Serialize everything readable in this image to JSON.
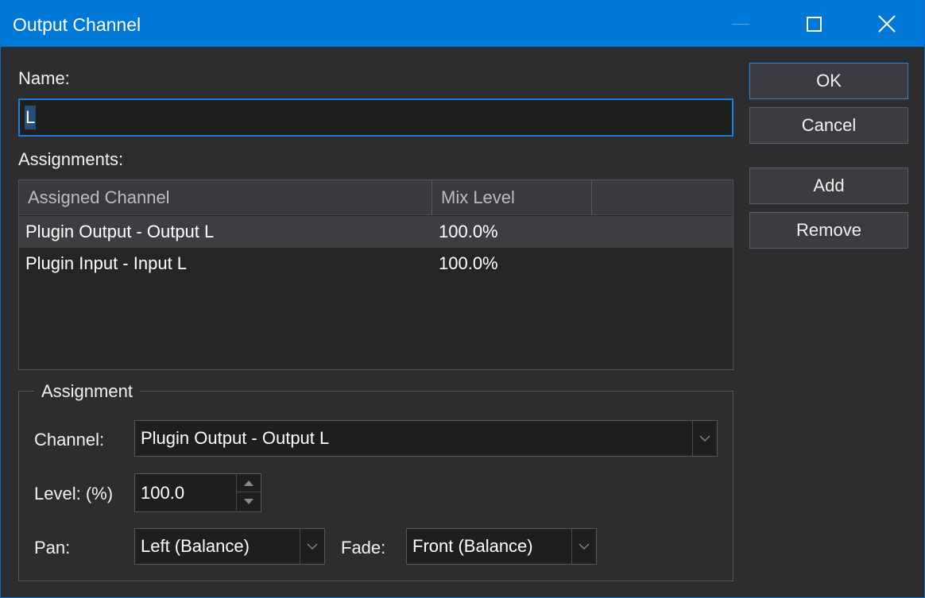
{
  "window": {
    "title": "Output Channel"
  },
  "name": {
    "label": "Name:",
    "value": "L"
  },
  "assignments": {
    "label": "Assignments:",
    "columns": [
      "Assigned Channel",
      "Mix Level",
      ""
    ],
    "rows": [
      {
        "channel": "Plugin Output - Output L",
        "mix": "100.0%",
        "selected": true
      },
      {
        "channel": "Plugin Input - Input L",
        "mix": "100.0%",
        "selected": false
      }
    ]
  },
  "buttons": {
    "ok": "OK",
    "cancel": "Cancel",
    "add": "Add",
    "remove": "Remove"
  },
  "assignment_group": {
    "title": "Assignment",
    "channel_label": "Channel:",
    "channel_value": "Plugin Output - Output L",
    "level_label": "Level: (%)",
    "level_value": "100.0",
    "pan_label": "Pan:",
    "pan_value": "Left (Balance)",
    "fade_label": "Fade:",
    "fade_value": "Front (Balance)"
  },
  "icons": {
    "minimize": "minimize-icon",
    "maximize": "maximize-icon",
    "close": "close-icon",
    "dropdown": "chevron-down-icon",
    "spin_up": "triangle-up-icon",
    "spin_down": "triangle-down-icon"
  },
  "colors": {
    "titlebar": "#0078d7",
    "background": "#2d2d30",
    "input_bg": "#1e1e1e",
    "selection": "#264f78",
    "focus_border": "#1e7fd4"
  }
}
